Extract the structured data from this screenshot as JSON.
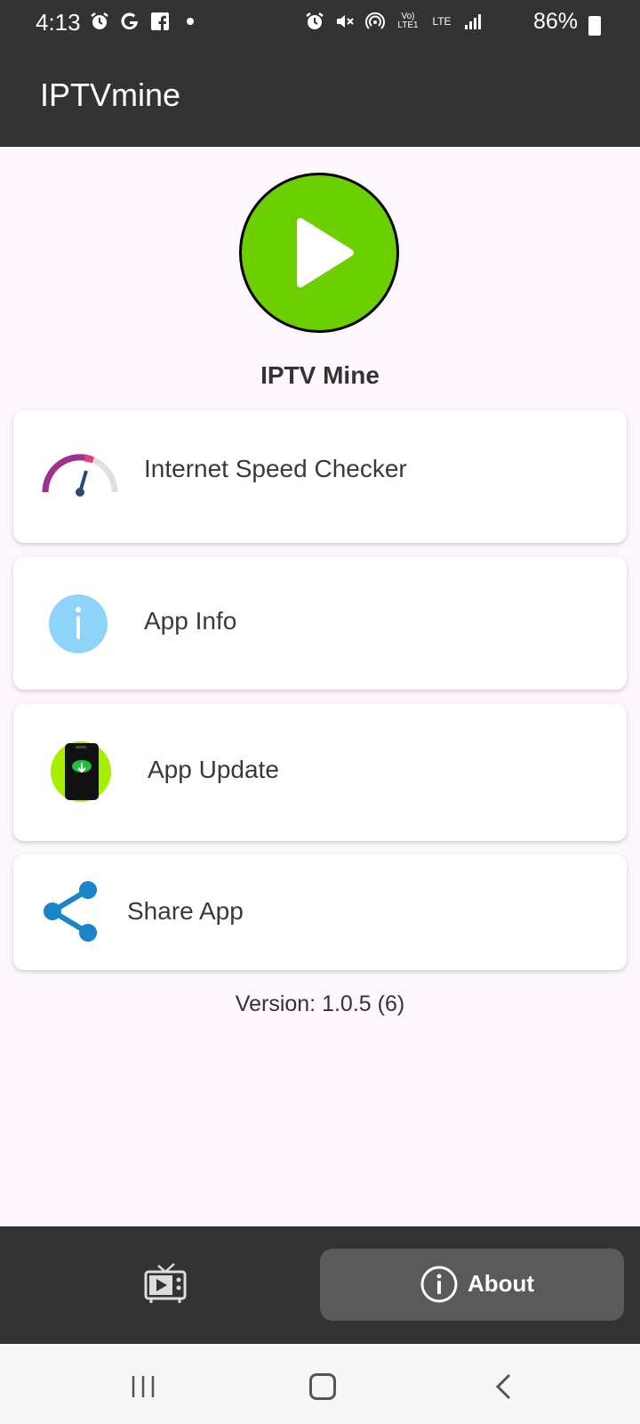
{
  "status_bar": {
    "time": "4:13",
    "left_icons": [
      "alarm-icon",
      "google-icon",
      "facebook-icon",
      "dot-icon"
    ],
    "right_icons": [
      "alarm-icon",
      "mute-icon",
      "hotspot-icon",
      "volte-icon",
      "lte-icon",
      "signal-icon"
    ],
    "volte_label": "Vo) LTE1",
    "lte_label": "LTE",
    "battery": "86%"
  },
  "app_bar": {
    "title": "IPTVmine"
  },
  "hero": {
    "title": "IPTV Mine",
    "accent": "#6ccf00"
  },
  "menu": {
    "speed_label": "Internet Speed Checker",
    "info_label": "App Info",
    "update_label": "App Update",
    "share_label": "Share App"
  },
  "version": "Version: 1.0.5 (6)",
  "bottom_nav": {
    "tv_icon": "tv-icon",
    "about_label": "About"
  },
  "colors": {
    "bar_bg": "#333333",
    "page_bg": "#fdf6fd",
    "share_blue": "#1a86c8",
    "info_blue": "#8fd4f8",
    "update_green": "#a8ee00"
  }
}
